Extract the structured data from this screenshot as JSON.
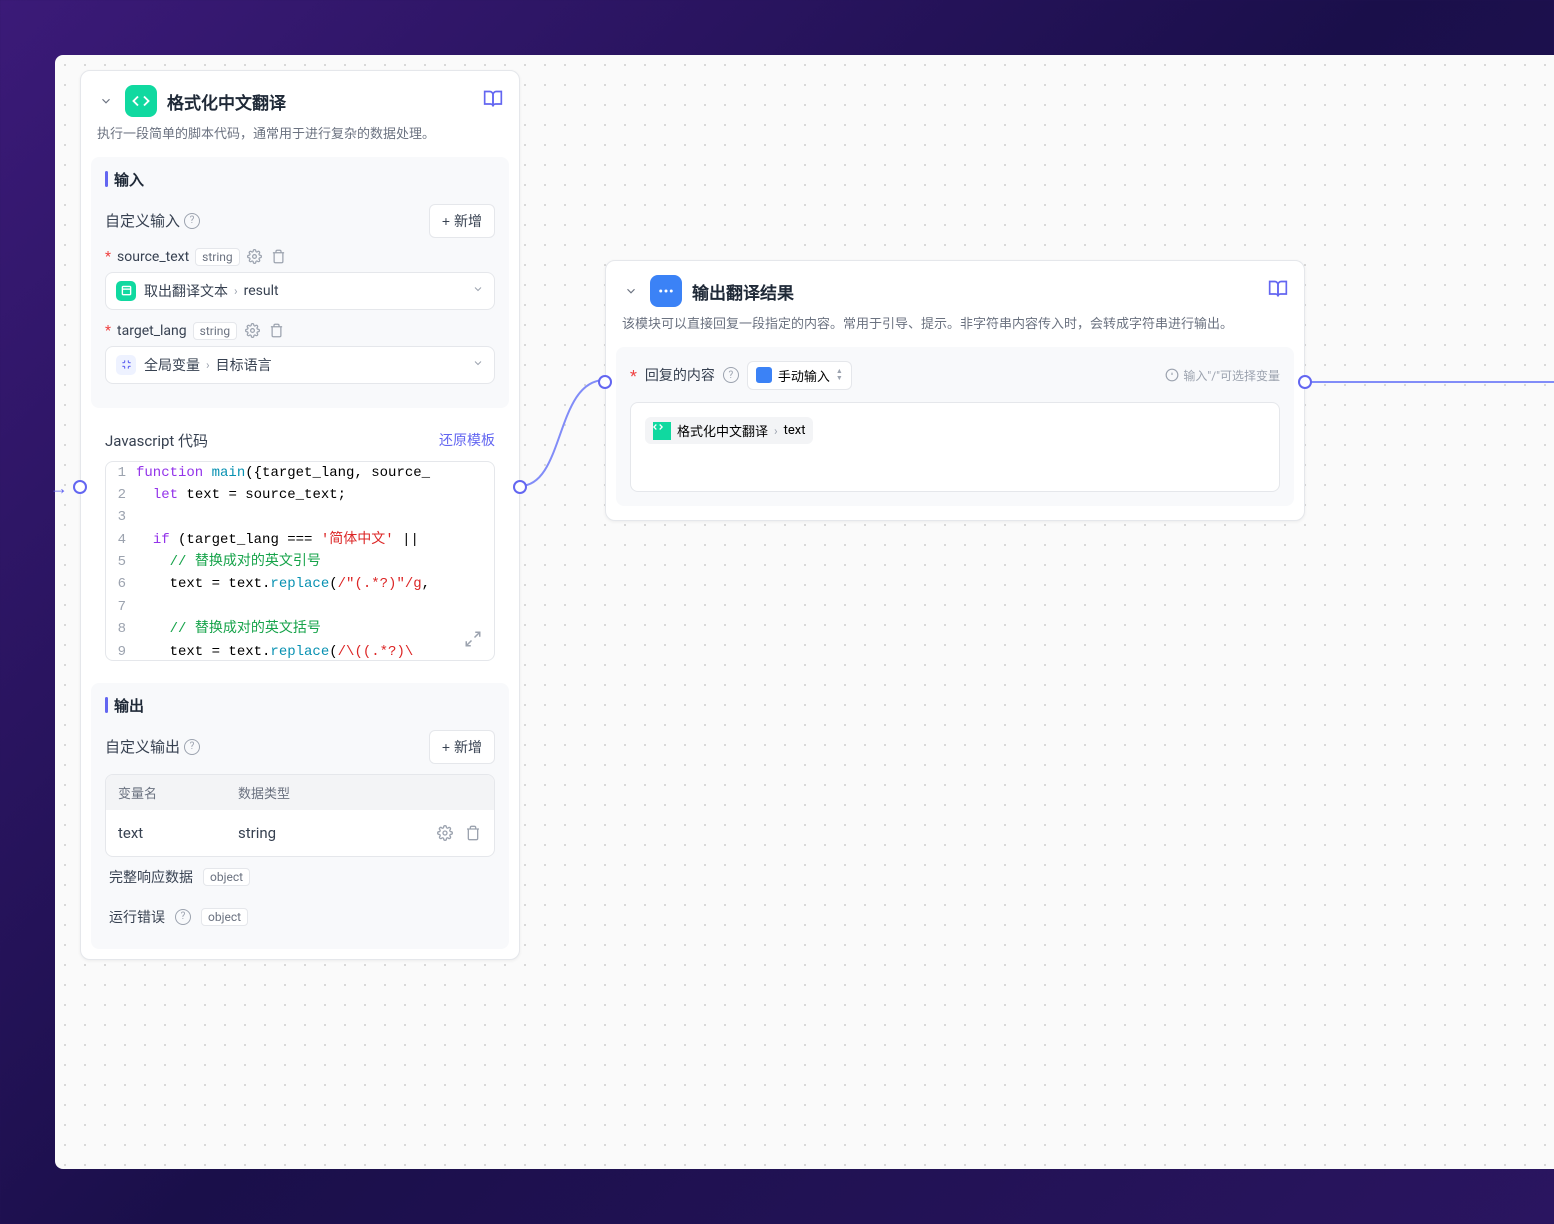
{
  "node_left": {
    "title": "格式化中文翻译",
    "description": "执行一段简单的脚本代码，通常用于进行复杂的数据处理。",
    "input_section": "输入",
    "custom_input_label": "自定义输入",
    "add_button": "+ 新增",
    "params": [
      {
        "name": "source_text",
        "type": "string",
        "ref_icon": "green",
        "ref_source": "取出翻译文本",
        "ref_field": "result"
      },
      {
        "name": "target_lang",
        "type": "string",
        "ref_icon": "blue",
        "ref_source": "全局变量",
        "ref_field": "目标语言"
      }
    ],
    "code_title": "Javascript 代码",
    "restore_template": "还原模板",
    "code_lines": [
      {
        "n": 1,
        "html": "<span class='kw'>function</span> <span class='fn'>main</span>({target_lang, source_"
      },
      {
        "n": 2,
        "html": "  <span class='kw'>let</span> text = source_text;"
      },
      {
        "n": 3,
        "html": ""
      },
      {
        "n": 4,
        "html": "  <span class='kw'>if</span> (target_lang === <span class='str'>'简体中文'</span> || "
      },
      {
        "n": 5,
        "html": "    <span class='cmt'>// 替换成对的英文引号</span>"
      },
      {
        "n": 6,
        "html": "    text = text.<span class='fn'>replace</span>(<span class='str'>/\"(.​*?)\"/g</span>,"
      },
      {
        "n": 7,
        "html": ""
      },
      {
        "n": 8,
        "html": "    <span class='cmt'>// 替换成对的英文括号</span>"
      },
      {
        "n": 9,
        "html": "    text = text.<span class='fn'>replace</span>(<span class='str'>/\\((.​*?)\\</span>"
      }
    ],
    "output_section": "输出",
    "custom_output_label": "自定义输出",
    "table_headers": {
      "var_name": "变量名",
      "data_type": "数据类型"
    },
    "output_rows": [
      {
        "name": "text",
        "type": "string"
      }
    ],
    "full_response_label": "完整响应数据",
    "full_response_type": "object",
    "run_error_label": "运行错误",
    "run_error_type": "object"
  },
  "node_right": {
    "title": "输出翻译结果",
    "description": "该模块可以直接回复一段指定的内容。常用于引导、提示。非字符串内容传入时，会转成字符串进行输出。",
    "reply_label": "回复的内容",
    "manual_input": "手动输入",
    "hint": "输入\"/\"可选择变量",
    "var_source": "格式化中文翻译",
    "var_field": "text"
  }
}
